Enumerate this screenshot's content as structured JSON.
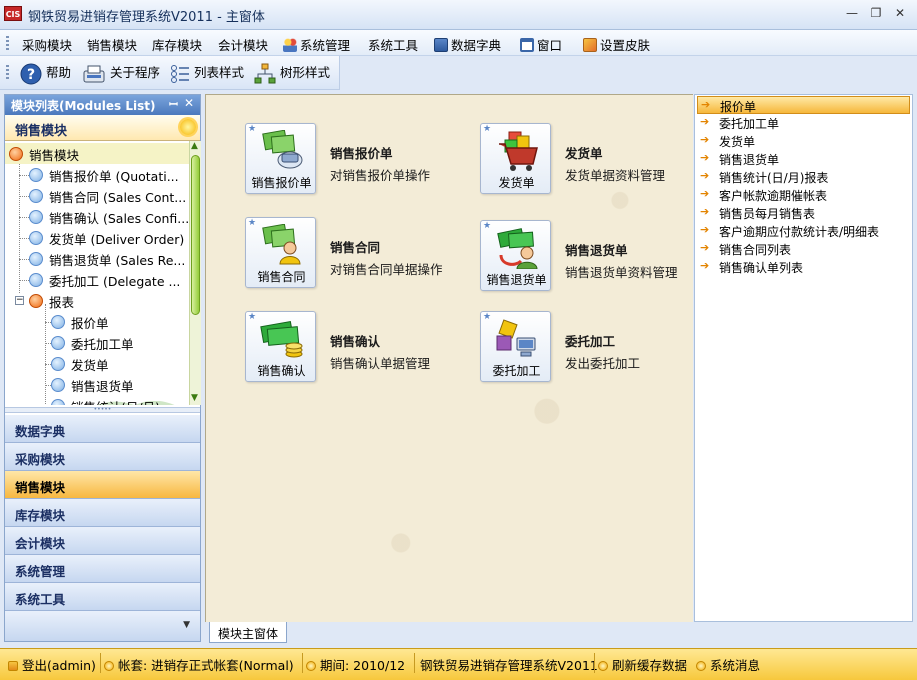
{
  "window": {
    "logo_text": "CIS",
    "title": "钢铁贸易进销存管理系统V2011 - 主窗体",
    "minimize": "—",
    "restore": "❐",
    "close": "✕"
  },
  "menubar": {
    "items": [
      "采购模块",
      "销售模块",
      "库存模块",
      "会计模块",
      "系统管理",
      "系统工具",
      "数据字典",
      "窗口",
      "设置皮肤"
    ]
  },
  "toolbar": {
    "items": [
      "帮助",
      "关于程序",
      "列表样式",
      "树形样式"
    ]
  },
  "left_panel": {
    "header": "模块列表(Modules List)",
    "pin": "ꟷ",
    "close": "✕",
    "section": "销售模块",
    "tree": [
      "销售模块",
      "销售报价单 (Quotati...",
      "销售合同 (Sales Cont...",
      "销售确认 (Sales Confi...",
      "发货单 (Deliver Order)",
      "销售退货单 (Sales Re...",
      "委托加工 (Delegate ...",
      "报表",
      "报价单",
      "委托加工单",
      "发货单",
      "销售退货单",
      "销售统计(日/月)"
    ],
    "modules": [
      "数据字典",
      "采购模块",
      "销售模块",
      "库存模块",
      "会计模块",
      "系统管理",
      "系统工具"
    ],
    "active_module": "销售模块"
  },
  "main": {
    "cards": [
      {
        "tile": "销售报价单",
        "title": "销售报价单",
        "desc": "对销售报价单操作"
      },
      {
        "tile": "发货单",
        "title": "发货单",
        "desc": "发货单据资料管理"
      },
      {
        "tile": "销售合同",
        "title": "销售合同",
        "desc": "对销售合同单据操作"
      },
      {
        "tile": "销售退货单",
        "title": "销售退货单",
        "desc": "销售退货单资料管理"
      },
      {
        "tile": "销售确认",
        "title": "销售确认",
        "desc": "销售确认单据管理"
      },
      {
        "tile": "委托加工",
        "title": "委托加工",
        "desc": "发出委托加工"
      }
    ],
    "tab": "模块主窗体"
  },
  "right_list": {
    "items": [
      "报价单",
      "委托加工单",
      "发货单",
      "销售退货单",
      "销售统计(日/月)报表",
      "客户帐款逾期催帐表",
      "销售员每月销售表",
      "客户逾期应付款统计表/明细表",
      "销售合同列表",
      "销售确认单列表"
    ],
    "selected": "报价单"
  },
  "statusbar": {
    "login": "登出(admin)",
    "account": "帐套: 进销存正式帐套(Normal)",
    "period": "期间: 2010/12",
    "system": "钢铁贸易进销存管理系统V2011",
    "refresh": "刷新缓存数据",
    "message": "系统消息"
  }
}
